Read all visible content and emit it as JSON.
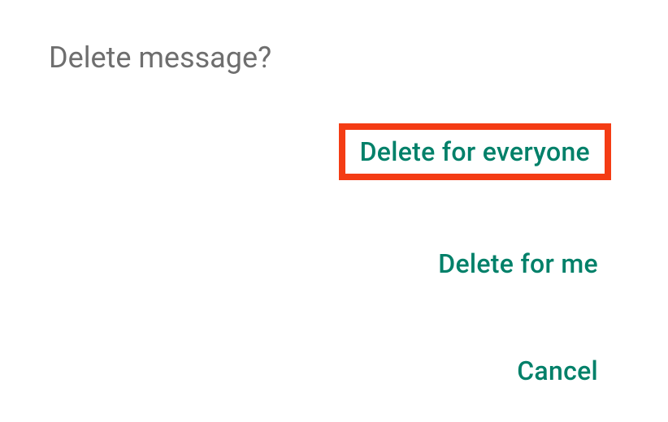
{
  "dialog": {
    "title": "Delete message?",
    "buttons": {
      "delete_everyone": "Delete for everyone",
      "delete_me": "Delete for me",
      "cancel": "Cancel"
    }
  }
}
